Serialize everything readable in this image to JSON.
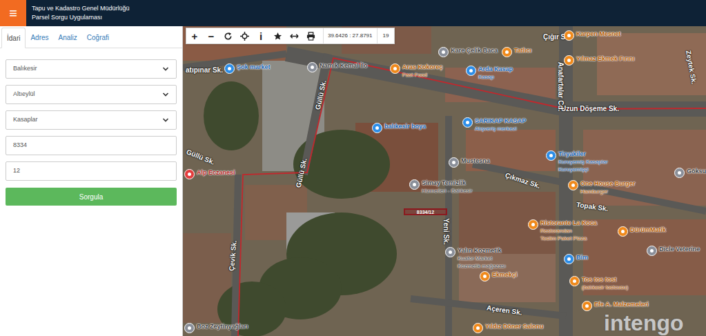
{
  "header": {
    "menu_icon": "≡",
    "title": "Tapu ve Kadastro Genel Müdürlüğü",
    "subtitle": "Parsel Sorgu Uygulaması"
  },
  "tabs": [
    {
      "label": "İdari",
      "selected": true
    },
    {
      "label": "Adres",
      "selected": false
    },
    {
      "label": "Analiz",
      "selected": false
    },
    {
      "label": "Coğrafi",
      "selected": false
    }
  ],
  "form": {
    "fields": [
      {
        "kind": "select",
        "value": "Balıkesir"
      },
      {
        "kind": "select",
        "value": "Altıeylül"
      },
      {
        "kind": "select",
        "value": "Kasaplar"
      },
      {
        "kind": "input",
        "value": "8334"
      },
      {
        "kind": "input",
        "value": "12"
      }
    ],
    "button": "Sorgula"
  },
  "toolbar": {
    "glyphs": [
      "+",
      "−",
      "i"
    ],
    "coordinates": "39.6426 : 27.8791",
    "zoom": "19"
  },
  "map": {
    "parcel_label": "8334/12",
    "streets": [
      "atıpınar Sk.",
      "Güllü Sk.",
      "Güllü Sk.",
      "Güllü Sk.",
      "Çığır Sk.",
      "Uzun Döşeme Sk.",
      "Anafartalar Cd.",
      "Çıkmaz Sk.",
      "Topak Sk.",
      "Yeni Sk.",
      "Çevik Sk.",
      "Açeren Sk.",
      "Zeytek Sk."
    ],
    "pois": [
      {
        "lines": [
          "Şok market"
        ],
        "kind": "shop"
      },
      {
        "lines": [
          "Namık Kemal İlo"
        ],
        "kind": "place"
      },
      {
        "lines": [
          "Aras Kokoreç",
          "Fast Food"
        ],
        "kind": "food"
      },
      {
        "lines": [
          "Kare Çelik Baca"
        ],
        "kind": "place"
      },
      {
        "lines": [
          "Tatlıcı"
        ],
        "kind": "food"
      },
      {
        "lines": [
          "Arda Kasap",
          "Kasap"
        ],
        "kind": "shop"
      },
      {
        "lines": [
          "Karpen Mesnet"
        ],
        "kind": "food"
      },
      {
        "lines": [
          "Yılmaz Ekmek Fırını"
        ],
        "kind": "food"
      },
      {
        "lines": [
          "balıkesir boya"
        ],
        "kind": "shop"
      },
      {
        "lines": [
          "SARIKAP KASAP",
          "Alışveriş merkezi"
        ],
        "kind": "shop"
      },
      {
        "lines": [
          "Tiryakiler",
          "Kuruyemiş Kasaplar",
          "Kuruyemişçi"
        ],
        "kind": "shop"
      },
      {
        "lines": [
          "Mustesna"
        ],
        "kind": "place"
      },
      {
        "lines": [
          "Simay Temizlik",
          "Hizmetleri - Balıkesir"
        ],
        "kind": "place"
      },
      {
        "lines": [
          "One House Burger",
          "Hamburger"
        ],
        "kind": "food"
      },
      {
        "lines": [
          "Göksu"
        ],
        "kind": "place"
      },
      {
        "lines": [
          "Alp Eczanesi"
        ],
        "kind": "pharmacy"
      },
      {
        "lines": [
          "Ristorante La Koca",
          "Restorandan",
          "Teslim Paket Pizza"
        ],
        "kind": "food"
      },
      {
        "lines": [
          "DürümMatik"
        ],
        "kind": "food"
      },
      {
        "lines": [
          "Yalın Kozmetik",
          "Kuafor Market",
          "Kozmetik mağazası"
        ],
        "kind": "place"
      },
      {
        "lines": [
          "Bim"
        ],
        "kind": "shop"
      },
      {
        "lines": [
          "Dicle Veterine"
        ],
        "kind": "place"
      },
      {
        "lines": [
          "Ekmekçi"
        ],
        "kind": "food"
      },
      {
        "lines": [
          "Tos tos tost",
          "(balıkesir tostcusu)"
        ],
        "kind": "food"
      },
      {
        "lines": [
          "Efe A. Malzemeleri"
        ],
        "kind": "food"
      },
      {
        "lines": [
          "Yıldız Döner Salonu"
        ],
        "kind": "food"
      },
      {
        "lines": [
          "Boz Zeytinyağları"
        ],
        "kind": "place"
      }
    ],
    "watermark": "intengo"
  }
}
